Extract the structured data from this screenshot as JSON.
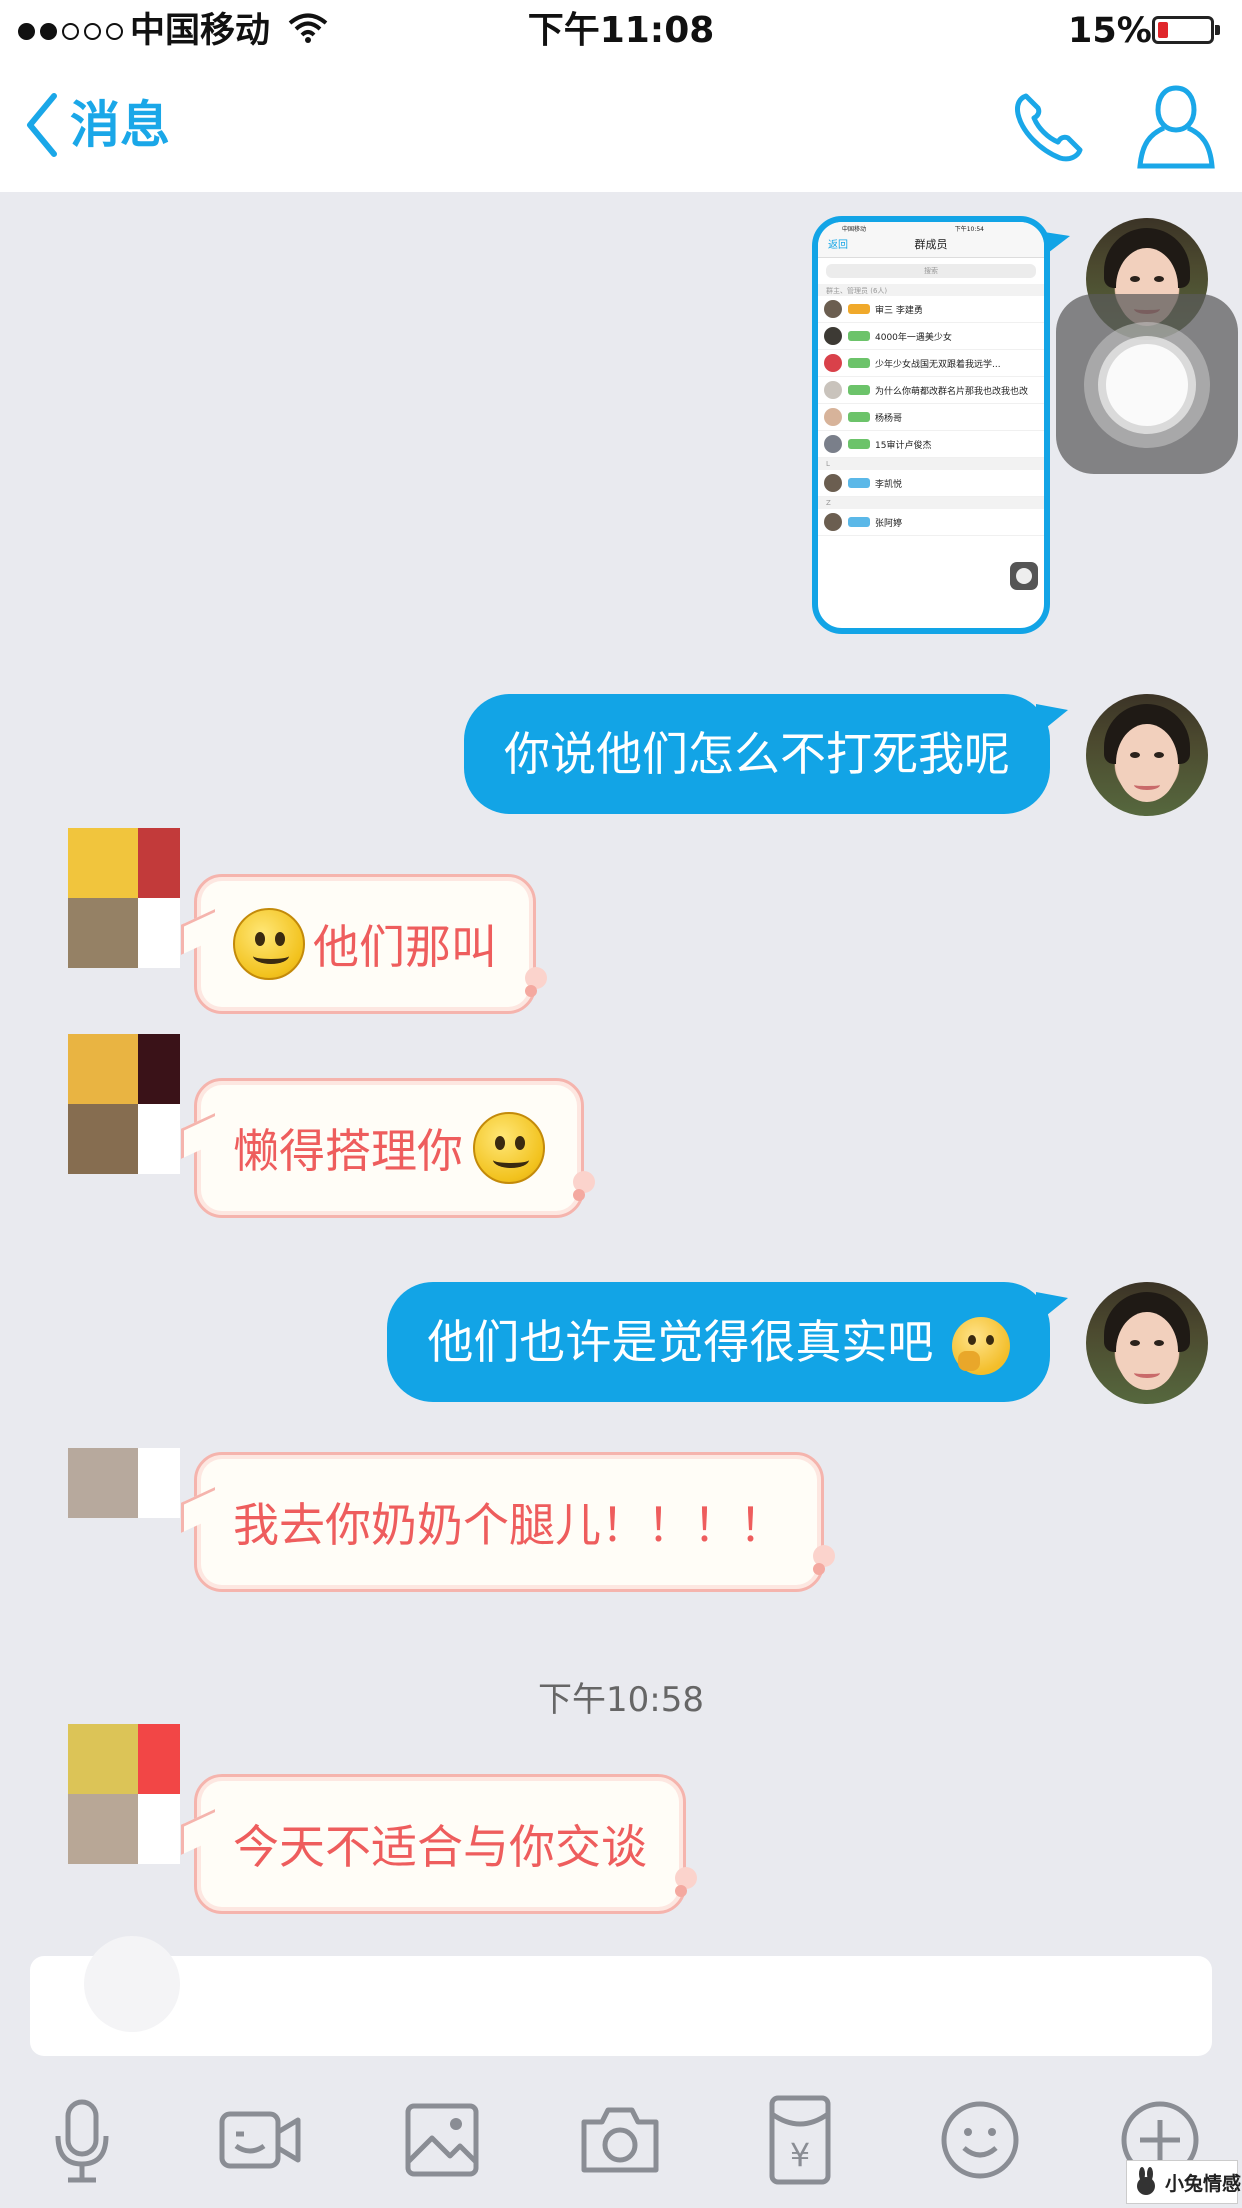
{
  "status_bar": {
    "carrier": "中国移动",
    "time": "下午11:08",
    "battery_percent": "15%",
    "signal_bars": 2,
    "signal_total": 5,
    "battery_level": 0.15
  },
  "nav": {
    "back_label": "消息",
    "icons": [
      "chevron-left-icon",
      "phone-icon",
      "profile-icon"
    ]
  },
  "messages": [
    {
      "direction": "outgoing",
      "type": "image",
      "screenshot": {
        "carrier": "中国移动",
        "time": "下午10:54",
        "back_label": "返回",
        "title": "群成员",
        "search_placeholder": "搜索",
        "section_admins": "群主、管理员 (6人)",
        "rows": [
          {
            "name": "审三 李建勇",
            "tag_color": "#f0a92b"
          },
          {
            "name": "4000年一遇美少女",
            "tag_color": "#6cc36a"
          },
          {
            "name": "少年少女战国无双跟着我远学...",
            "tag_color": "#6cc36a"
          },
          {
            "name": "为什么你萌都改群名片那我也改我也改",
            "tag_color": "#6cc36a"
          },
          {
            "name": "杨杨哥",
            "tag_color": "#6cc36a"
          },
          {
            "name": "15审计卢俊杰",
            "tag_color": "#6cc36a"
          }
        ],
        "section_l": "L",
        "rows_l": [
          {
            "name": "李凯悦",
            "tag_color": "#5bb8e8"
          }
        ],
        "section_z": "Z",
        "rows_z": [
          {
            "name": "张阿婷",
            "tag_color": "#5bb8e8"
          }
        ]
      }
    },
    {
      "direction": "outgoing",
      "type": "text",
      "text": "你说他们怎么不打死我呢"
    },
    {
      "direction": "incoming",
      "type": "text",
      "text": "他们那叫",
      "emoji_before": "smile-emoji"
    },
    {
      "direction": "incoming",
      "type": "text",
      "text": "懒得搭理你",
      "emoji_after": "smile-emoji"
    },
    {
      "direction": "outgoing",
      "type": "text",
      "text": "他们也许是觉得很真实吧",
      "emoji_after": "thinking-emoji"
    },
    {
      "direction": "incoming",
      "type": "text",
      "text": "我去你奶奶个腿儿！！！！"
    },
    {
      "type": "timestamp",
      "text": "下午10:58"
    },
    {
      "direction": "incoming",
      "type": "text",
      "text": "今天不适合与你交谈"
    }
  ],
  "toolbar": {
    "items": [
      "microphone-icon",
      "video-icon",
      "image-icon",
      "camera-icon",
      "red-packet-icon",
      "emoji-icon",
      "plus-icon"
    ],
    "red_packet_symbol": "¥"
  },
  "watermark": {
    "text": "小兔情感"
  },
  "colors": {
    "accent": "#1aa7e8",
    "outgoing_bubble": "#12a4e6",
    "incoming_text": "#ee5d5d",
    "incoming_border": "#f5b4ad",
    "background": "#e9eaef"
  }
}
